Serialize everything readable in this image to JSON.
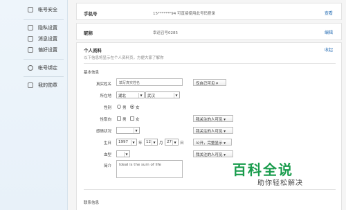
{
  "sidebar": {
    "items": [
      {
        "label": "帐号安全",
        "icon": "shield-icon"
      },
      {
        "label": "隐私设置",
        "icon": "lock-icon"
      },
      {
        "label": "消息设置",
        "icon": "message-icon"
      },
      {
        "label": "偏好设置",
        "icon": "preferences-icon"
      },
      {
        "label": "帐号绑定",
        "icon": "link-icon"
      },
      {
        "label": "我的勋章",
        "icon": "medal-icon"
      }
    ]
  },
  "phone": {
    "label": "手机号",
    "value": "15*******94 可直接使用此号码登录",
    "action": "查看"
  },
  "nickname": {
    "label": "昵称",
    "value": "幸运召号0285",
    "action": "编辑"
  },
  "profile": {
    "title": "个人资料",
    "subtitle": "以下信息将显示在个人资料页，方便大家了解你",
    "collapse": "收起",
    "basic_section": "基本信息",
    "realname": {
      "label": "真实姓名",
      "placeholder": "填写真实姓名",
      "privacy": "仅自己可见"
    },
    "location": {
      "label": "所在地",
      "province": "湖北",
      "city": "武汉"
    },
    "gender": {
      "label": "性别",
      "male": "男",
      "female": "女",
      "selected": "female"
    },
    "orientation": {
      "label": "性取向",
      "male": "男",
      "female": "女",
      "privacy": "我关注的人可见"
    },
    "relationship": {
      "label": "感情状况",
      "privacy": "我关注的人可见"
    },
    "birthday": {
      "label": "生日",
      "year": "1997",
      "year_unit": "年",
      "month": "12",
      "month_unit": "月",
      "day": "27",
      "day_unit": "日",
      "privacy": "公开，完整显示"
    },
    "blood": {
      "label": "血型",
      "privacy": "我关注的人可见"
    },
    "bio": {
      "label": "简介",
      "value": "Ideal is the sum of life"
    },
    "contact_section": "联系信息"
  },
  "watermark": {
    "title": "百科全说",
    "subtitle": "助你轻松解决",
    "color": "#1a9c4d"
  },
  "colors": {
    "link": "#2a6fb5",
    "sidebar_bg": "#eef5fb"
  }
}
